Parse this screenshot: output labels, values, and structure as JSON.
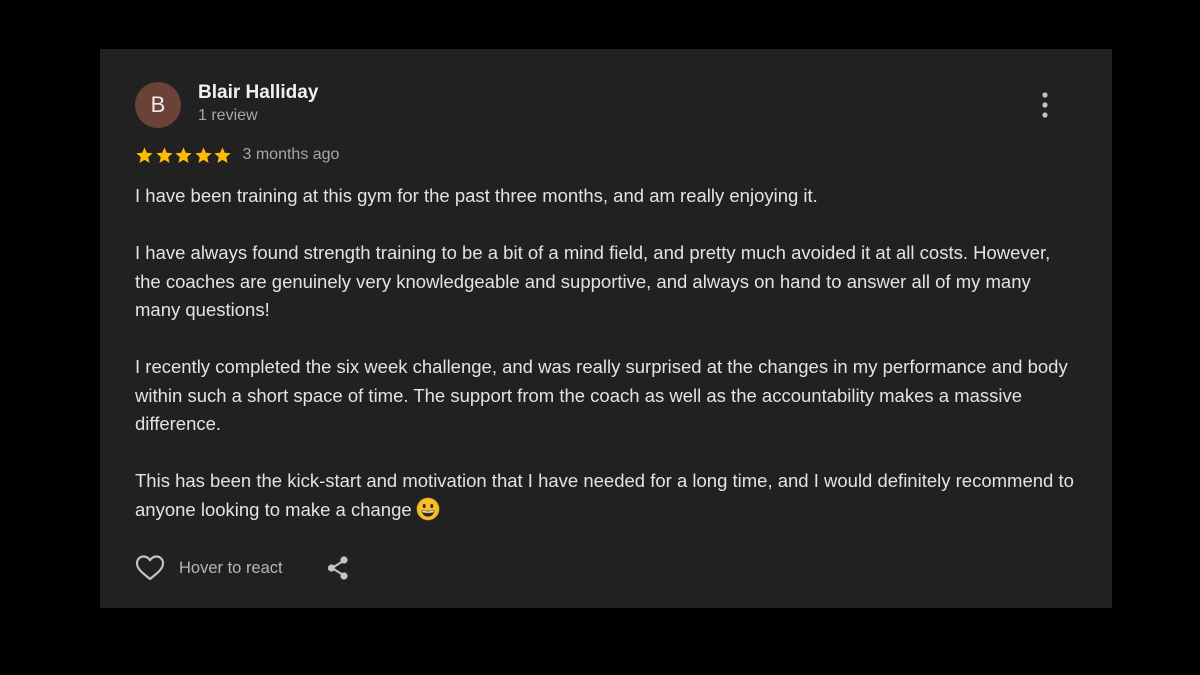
{
  "reviewer": {
    "initial": "B",
    "name": "Blair Halliday",
    "review_count": "1 review",
    "avatar_color": "#6a4237"
  },
  "rating": {
    "stars": 5,
    "max_stars": 5,
    "star_color": "#fbbc04"
  },
  "review": {
    "date": "3 months ago",
    "paragraphs": [
      "I have been training at this gym for the past three months, and am really enjoying it.",
      "I have always found strength training to be a bit of a mind field, and pretty much avoided it at all costs. However, the coaches are genuinely very knowledgeable and supportive, and always on hand to answer all of my many many questions!",
      "I recently completed the six week challenge, and was really surprised at the changes in my performance and body within such a short space of time. The support from the coach as well as the accountability makes a massive difference.",
      "This has been the kick-start and motivation that I have needed for a long time, and I would definitely recommend to anyone looking to make a change"
    ],
    "trailing_emoji": "smiling-face-emoji"
  },
  "actions": {
    "react_label": "Hover to react",
    "react_icon": "heart-outline-icon",
    "share_icon": "share-icon",
    "more_icon": "more-vertical-icon"
  },
  "colors": {
    "page_background": "#000000",
    "card_background": "#212121",
    "text_primary": "#e3e3e3",
    "text_secondary": "#a6a6a6"
  }
}
